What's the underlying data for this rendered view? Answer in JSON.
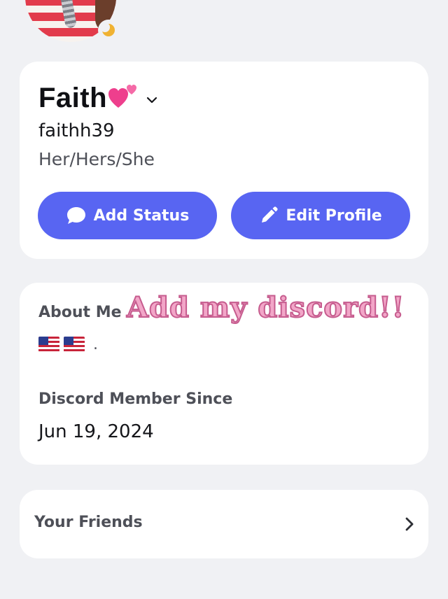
{
  "profile": {
    "display_name": "Faith",
    "username": "faithh39",
    "pronouns": "Her/Hers/She",
    "status_indicator": "idle",
    "add_status_label": "Add Status",
    "edit_profile_label": "Edit Profile"
  },
  "about": {
    "label": "About Me",
    "overlay_text": "Add my discord!!",
    "bio_suffix": ".",
    "bio_flags": [
      "us-flag-icon",
      "us-flag-icon"
    ],
    "member_since_label": "Discord Member Since",
    "member_since_date": "Jun 19, 2024"
  },
  "friends": {
    "label": "Your Friends"
  },
  "colors": {
    "background": "#f0f1f4",
    "card": "#ffffff",
    "accent": "#5865f2",
    "muted_text": "#4e5058",
    "idle": "#f0b232",
    "overlay_text": "#f2a6c8"
  }
}
